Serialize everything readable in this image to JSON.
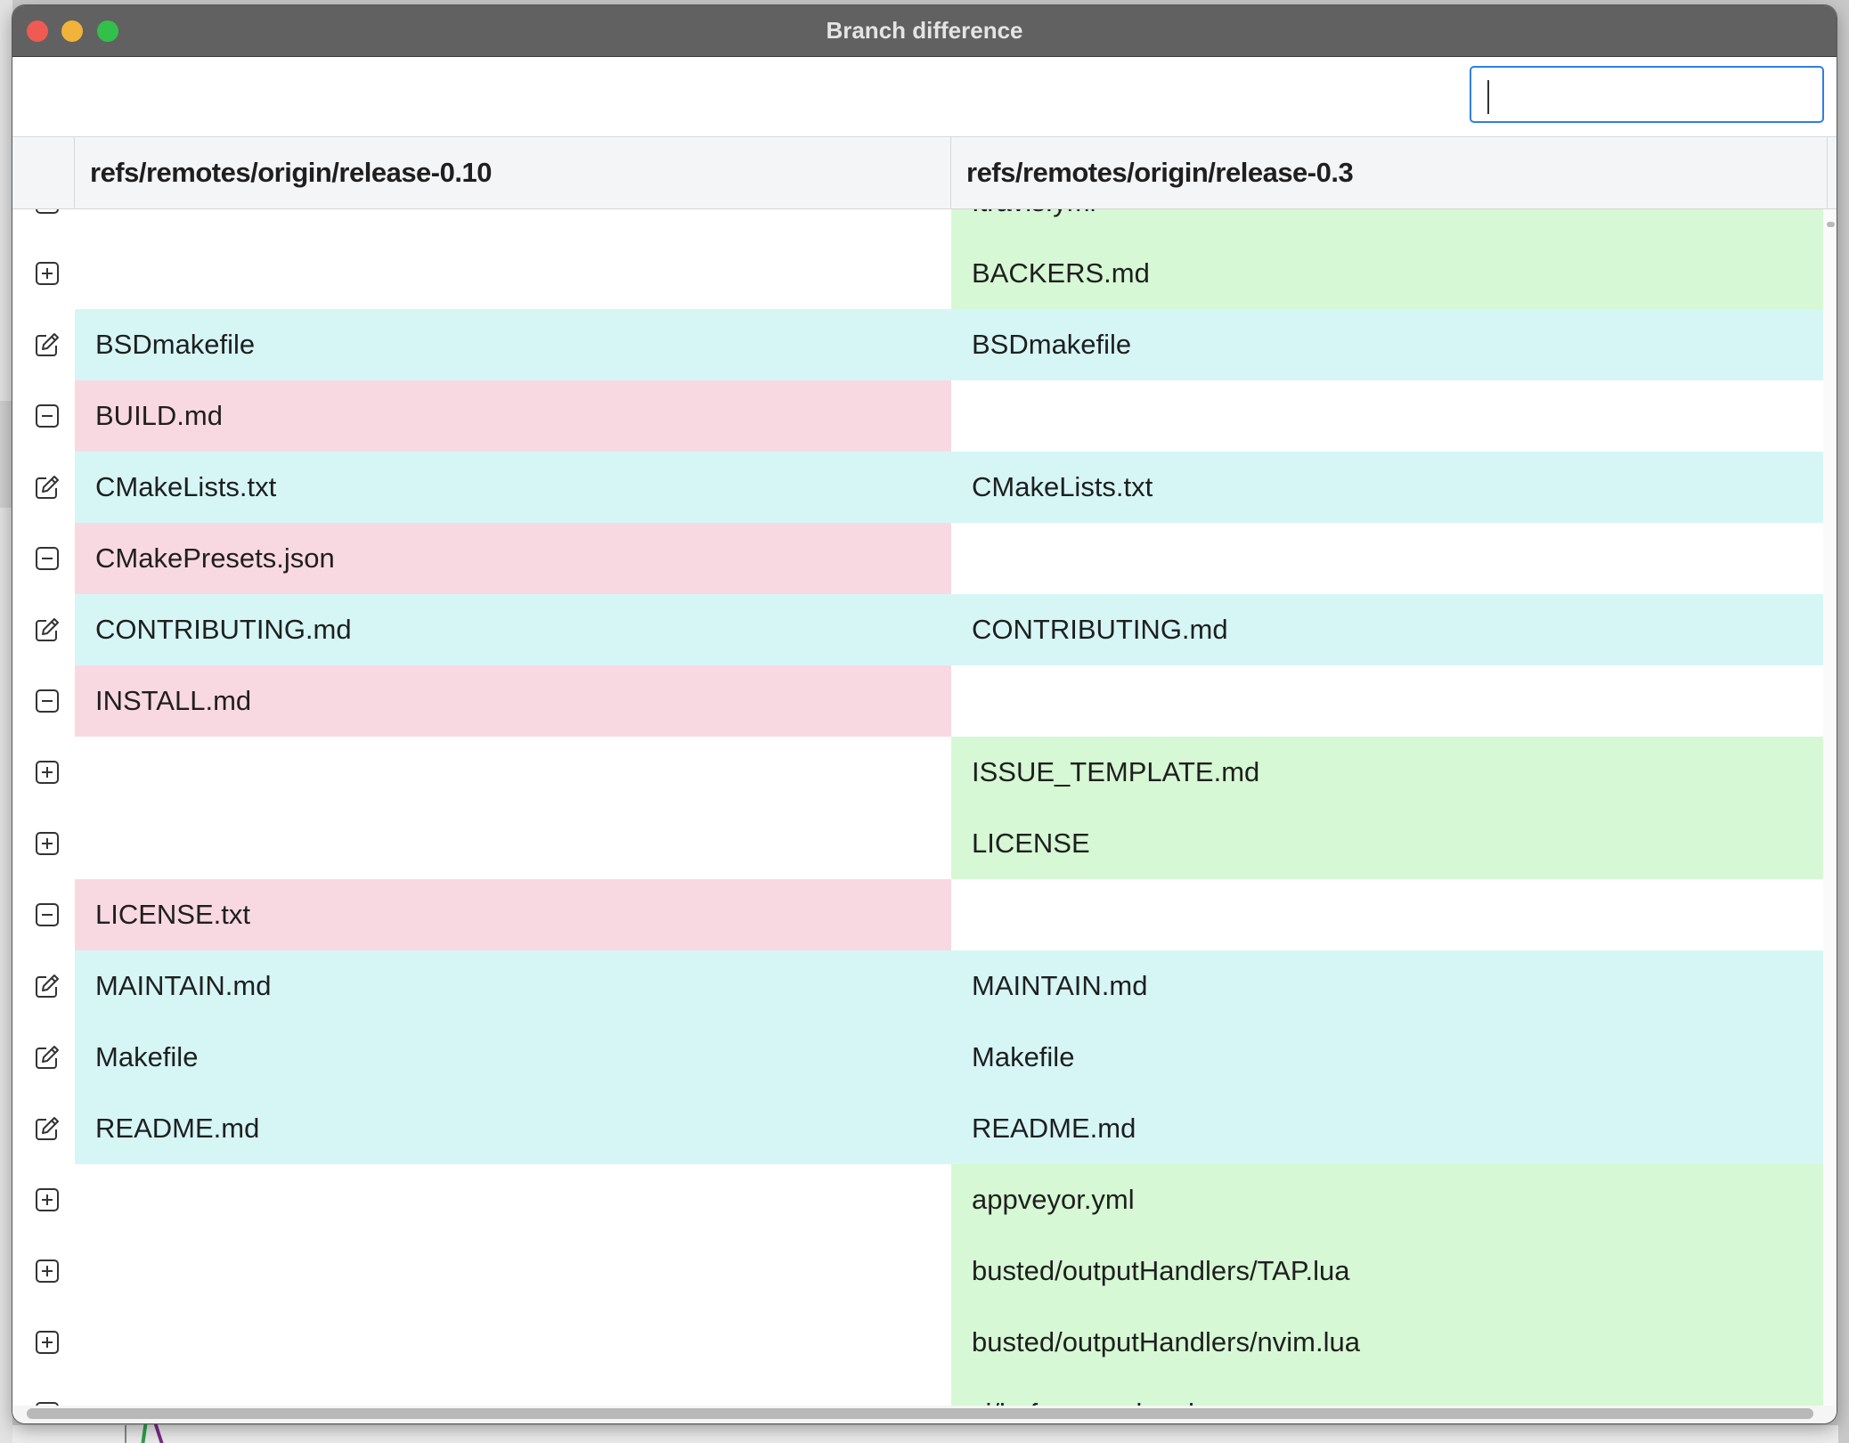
{
  "window": {
    "title": "Branch difference"
  },
  "search": {
    "value": "",
    "placeholder": ""
  },
  "columns": {
    "left": "refs/remotes/origin/release-0.10",
    "right": "refs/remotes/origin/release-0.3"
  },
  "colors": {
    "modified": "#d6f6f6",
    "removed": "#f9d9e1",
    "added": "#d6f8d4",
    "search_focus": "#2f7fe0"
  },
  "rows": [
    {
      "status": "added",
      "icon": "minus-square-icon",
      "left": "",
      "right": ".travis.yml"
    },
    {
      "status": "added",
      "icon": "plus-square-icon",
      "left": "",
      "right": "BACKERS.md"
    },
    {
      "status": "modified",
      "icon": "edit-icon",
      "left": "BSDmakefile",
      "right": "BSDmakefile"
    },
    {
      "status": "removed",
      "icon": "minus-square-icon",
      "left": "BUILD.md",
      "right": ""
    },
    {
      "status": "modified",
      "icon": "edit-icon",
      "left": "CMakeLists.txt",
      "right": "CMakeLists.txt"
    },
    {
      "status": "removed",
      "icon": "minus-square-icon",
      "left": "CMakePresets.json",
      "right": ""
    },
    {
      "status": "modified",
      "icon": "edit-icon",
      "left": "CONTRIBUTING.md",
      "right": "CONTRIBUTING.md"
    },
    {
      "status": "removed",
      "icon": "minus-square-icon",
      "left": "INSTALL.md",
      "right": ""
    },
    {
      "status": "added",
      "icon": "plus-square-icon",
      "left": "",
      "right": "ISSUE_TEMPLATE.md"
    },
    {
      "status": "added",
      "icon": "plus-square-icon",
      "left": "",
      "right": "LICENSE"
    },
    {
      "status": "removed",
      "icon": "minus-square-icon",
      "left": "LICENSE.txt",
      "right": ""
    },
    {
      "status": "modified",
      "icon": "edit-icon",
      "left": "MAINTAIN.md",
      "right": "MAINTAIN.md"
    },
    {
      "status": "modified",
      "icon": "edit-icon",
      "left": "Makefile",
      "right": "Makefile"
    },
    {
      "status": "modified",
      "icon": "edit-icon",
      "left": "README.md",
      "right": "README.md"
    },
    {
      "status": "added",
      "icon": "plus-square-icon",
      "left": "",
      "right": "appveyor.yml"
    },
    {
      "status": "added",
      "icon": "plus-square-icon",
      "left": "",
      "right": "busted/outputHandlers/TAP.lua"
    },
    {
      "status": "added",
      "icon": "plus-square-icon",
      "left": "",
      "right": "busted/outputHandlers/nvim.lua"
    },
    {
      "status": "added",
      "icon": "plus-square-icon",
      "left": "",
      "right": "ci/before_cache.sh"
    }
  ]
}
